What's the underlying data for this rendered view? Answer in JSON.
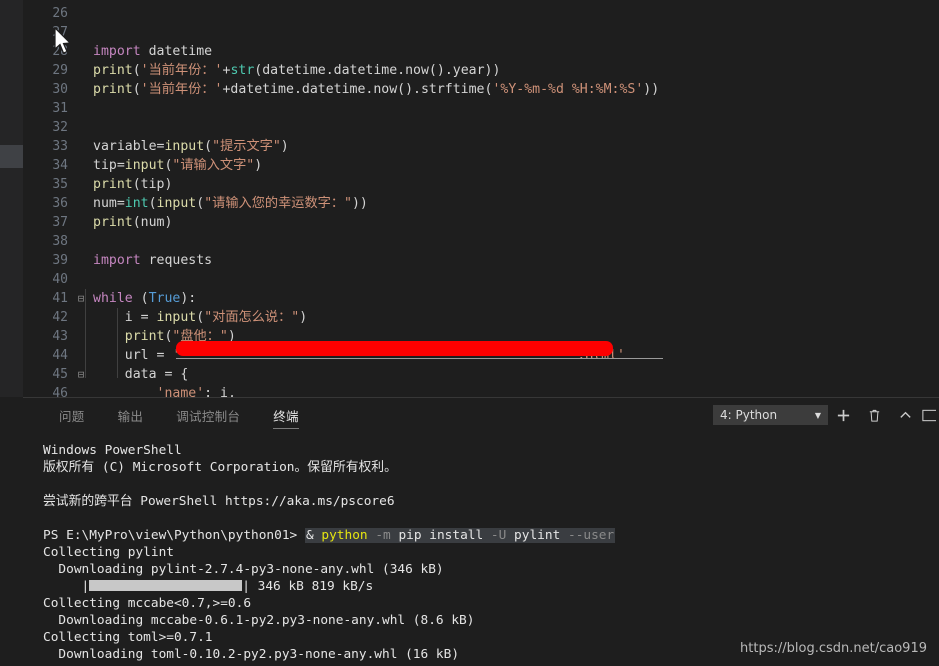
{
  "editor": {
    "first_line_number": 26,
    "lines": [
      {
        "n": 26,
        "fold": "",
        "indent": 0,
        "tokens": []
      },
      {
        "n": 27,
        "fold": "",
        "indent": 0,
        "tokens": []
      },
      {
        "n": 28,
        "fold": "",
        "indent": 0,
        "tokens": [
          {
            "t": "import",
            "c": "kw"
          },
          {
            "t": " datetime",
            "c": "plain"
          }
        ]
      },
      {
        "n": 29,
        "fold": "",
        "indent": 0,
        "tokens": [
          {
            "t": "print",
            "c": "fn"
          },
          {
            "t": "(",
            "c": "punc"
          },
          {
            "t": "'当前年份：'",
            "c": "str"
          },
          {
            "t": "+",
            "c": "punc"
          },
          {
            "t": "str",
            "c": "builtin"
          },
          {
            "t": "(datetime.datetime.now().year))",
            "c": "plain"
          }
        ]
      },
      {
        "n": 30,
        "fold": "",
        "indent": 0,
        "tokens": [
          {
            "t": "print",
            "c": "fn"
          },
          {
            "t": "(",
            "c": "punc"
          },
          {
            "t": "'当前年份：'",
            "c": "str"
          },
          {
            "t": "+datetime.datetime.now().strftime(",
            "c": "plain"
          },
          {
            "t": "'%Y-%m-%d %H:%M:%S'",
            "c": "str"
          },
          {
            "t": "))",
            "c": "plain"
          }
        ]
      },
      {
        "n": 31,
        "fold": "",
        "indent": 0,
        "tokens": []
      },
      {
        "n": 32,
        "fold": "",
        "indent": 0,
        "tokens": []
      },
      {
        "n": 33,
        "fold": "",
        "indent": 0,
        "tokens": [
          {
            "t": "variable=",
            "c": "plain"
          },
          {
            "t": "input",
            "c": "fn"
          },
          {
            "t": "(",
            "c": "punc"
          },
          {
            "t": "\"提示文字\"",
            "c": "str"
          },
          {
            "t": ")",
            "c": "punc"
          }
        ]
      },
      {
        "n": 34,
        "fold": "",
        "indent": 0,
        "tokens": [
          {
            "t": "tip=",
            "c": "plain"
          },
          {
            "t": "input",
            "c": "fn"
          },
          {
            "t": "(",
            "c": "punc"
          },
          {
            "t": "\"请输入文字\"",
            "c": "str"
          },
          {
            "t": ")",
            "c": "punc"
          }
        ]
      },
      {
        "n": 35,
        "fold": "",
        "indent": 0,
        "tokens": [
          {
            "t": "print",
            "c": "fn"
          },
          {
            "t": "(tip)",
            "c": "plain"
          }
        ]
      },
      {
        "n": 36,
        "fold": "",
        "indent": 0,
        "tokens": [
          {
            "t": "num=",
            "c": "plain"
          },
          {
            "t": "int",
            "c": "builtin"
          },
          {
            "t": "(",
            "c": "punc"
          },
          {
            "t": "input",
            "c": "fn"
          },
          {
            "t": "(",
            "c": "punc"
          },
          {
            "t": "\"请输入您的幸运数字：\"",
            "c": "str"
          },
          {
            "t": "))",
            "c": "punc"
          }
        ]
      },
      {
        "n": 37,
        "fold": "",
        "indent": 0,
        "tokens": [
          {
            "t": "print",
            "c": "fn"
          },
          {
            "t": "(num)",
            "c": "plain"
          }
        ]
      },
      {
        "n": 38,
        "fold": "",
        "indent": 0,
        "tokens": []
      },
      {
        "n": 39,
        "fold": "",
        "indent": 0,
        "tokens": [
          {
            "t": "import",
            "c": "kw"
          },
          {
            "t": " requests",
            "c": "plain"
          }
        ]
      },
      {
        "n": 40,
        "fold": "",
        "indent": 0,
        "tokens": []
      },
      {
        "n": 41,
        "fold": "collapse",
        "indent": 0,
        "tokens": [
          {
            "t": "while",
            "c": "kw"
          },
          {
            "t": " (",
            "c": "punc"
          },
          {
            "t": "True",
            "c": "const"
          },
          {
            "t": "):",
            "c": "punc"
          }
        ]
      },
      {
        "n": 42,
        "fold": "",
        "indent": 1,
        "tokens": [
          {
            "t": "    i = ",
            "c": "plain"
          },
          {
            "t": "input",
            "c": "fn"
          },
          {
            "t": "(",
            "c": "punc"
          },
          {
            "t": "\"对面怎么说：\"",
            "c": "str"
          },
          {
            "t": ")",
            "c": "punc"
          }
        ]
      },
      {
        "n": 43,
        "fold": "",
        "indent": 1,
        "tokens": [
          {
            "t": "    ",
            "c": "plain"
          },
          {
            "t": "print",
            "c": "fn"
          },
          {
            "t": "(",
            "c": "punc"
          },
          {
            "t": "\"盘他：\"",
            "c": "str"
          },
          {
            "t": ")",
            "c": "punc"
          }
        ]
      },
      {
        "n": 44,
        "fold": "",
        "indent": 1,
        "redacted": true,
        "tokens": [
          {
            "t": "    url = ",
            "c": "plain"
          },
          {
            "t": "'",
            "c": "str"
          },
          {
            "t": "                                                  ",
            "c": "str"
          },
          {
            "t": ".Html'",
            "c": "str"
          }
        ]
      },
      {
        "n": 45,
        "fold": "collapse",
        "indent": 1,
        "tokens": [
          {
            "t": "    data = {",
            "c": "plain"
          }
        ]
      },
      {
        "n": 46,
        "fold": "",
        "indent": 2,
        "tokens": [
          {
            "t": "        ",
            "c": "plain"
          },
          {
            "t": "'name'",
            "c": "str"
          },
          {
            "t": ": i,",
            "c": "plain"
          }
        ]
      }
    ]
  },
  "panel": {
    "tabs": [
      {
        "label": "问题",
        "active": false
      },
      {
        "label": "输出",
        "active": false
      },
      {
        "label": "调试控制台",
        "active": false
      },
      {
        "label": "终端",
        "active": true
      }
    ],
    "terminal_selector": {
      "value": "4: Python",
      "caret": "▼"
    },
    "tools": [
      {
        "name": "new-terminal-button",
        "glyph": "+"
      },
      {
        "name": "kill-terminal-button",
        "glyph": "trash"
      },
      {
        "name": "maximize-panel-button",
        "glyph": "chevron-up"
      },
      {
        "name": "close-panel-button",
        "glyph": "panel"
      }
    ]
  },
  "terminal": {
    "lines": [
      {
        "type": "text",
        "segments": [
          {
            "t": "Windows PowerShell",
            "c": "c-white"
          }
        ]
      },
      {
        "type": "text",
        "segments": [
          {
            "t": "版权所有 (C) Microsoft Corporation。保留所有权利。",
            "c": "c-white"
          }
        ]
      },
      {
        "type": "blank"
      },
      {
        "type": "text",
        "segments": [
          {
            "t": "尝试新的跨平台 PowerShell https://aka.ms/pscore6",
            "c": "c-white"
          }
        ]
      },
      {
        "type": "blank"
      },
      {
        "type": "prompt",
        "prompt": "PS E:\\MyPro\\view\\Python\\python01> ",
        "segments": [
          {
            "t": "& ",
            "c": "c-white"
          },
          {
            "t": "python",
            "c": "c-yellow"
          },
          {
            "t": " ",
            "c": "c-white"
          },
          {
            "t": "-m",
            "c": "c-dim"
          },
          {
            "t": " pip install ",
            "c": "c-white"
          },
          {
            "t": "-U",
            "c": "c-dim"
          },
          {
            "t": " pylint ",
            "c": "c-white"
          },
          {
            "t": "--user",
            "c": "c-dim"
          }
        ]
      },
      {
        "type": "text",
        "segments": [
          {
            "t": "Collecting pylint",
            "c": "c-white"
          }
        ]
      },
      {
        "type": "text",
        "segments": [
          {
            "t": "  Downloading pylint-2.7.4-py3-none-any.whl (346 kB)",
            "c": "c-white"
          }
        ]
      },
      {
        "type": "progress",
        "prefix": "     |",
        "suffix": "| 346 kB 819 kB/s"
      },
      {
        "type": "text",
        "segments": [
          {
            "t": "Collecting mccabe<0.7,>=0.6",
            "c": "c-white"
          }
        ]
      },
      {
        "type": "text",
        "segments": [
          {
            "t": "  Downloading mccabe-0.6.1-py2.py3-none-any.whl (8.6 kB)",
            "c": "c-white"
          }
        ]
      },
      {
        "type": "text",
        "segments": [
          {
            "t": "Collecting toml>=0.7.1",
            "c": "c-white"
          }
        ]
      },
      {
        "type": "text",
        "segments": [
          {
            "t": "  Downloading toml-0.10.2-py2.py3-none-any.whl (16 kB)",
            "c": "c-white"
          }
        ]
      }
    ]
  },
  "watermark": {
    "text": "https://blog.csdn.net/cao919"
  },
  "colors": {
    "editor_bg": "#1e1e1e",
    "strip_bg": "#252526",
    "redaction": "#fe0000",
    "accent_yellow": "#e5e510",
    "progress_fill": "#c8c8c8"
  }
}
